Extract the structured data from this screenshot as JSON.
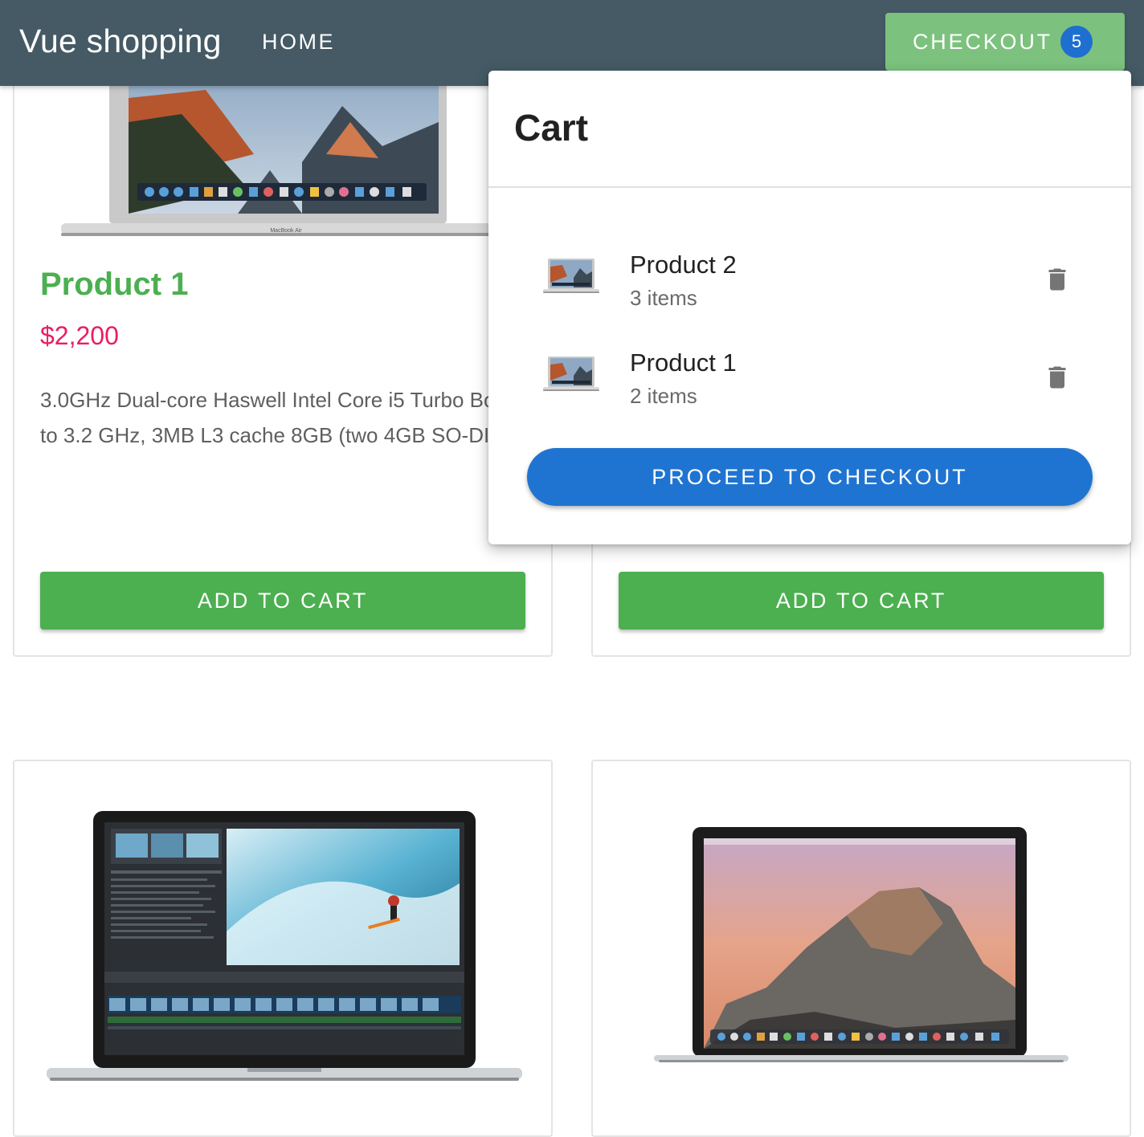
{
  "header": {
    "brand": "Vue shopping",
    "nav_home": "HOME",
    "checkout_label": "CHECKOUT",
    "cart_count": "5"
  },
  "products": [
    {
      "title": "Product 1",
      "price": "$2,200",
      "description": "3.0GHz Dual-core Haswell Intel Core i5 Turbo Boost up to 3.2 GHz, 3MB L3 cache 8GB (two 4GB SO-DIMMs...",
      "add_label": "ADD TO CART"
    },
    {
      "add_label": "ADD TO CART"
    }
  ],
  "cart": {
    "title": "Cart",
    "items": [
      {
        "name": "Product 2",
        "qty": "3 items"
      },
      {
        "name": "Product 1",
        "qty": "2 items"
      }
    ],
    "proceed_label": "PROCEED TO CHECKOUT"
  },
  "colors": {
    "topbar": "#455a64",
    "checkout_button": "#7cc27e",
    "badge": "#1e6fd0",
    "product_title": "#4caf50",
    "price": "#e91e63",
    "add_button": "#4caf50",
    "proceed_button": "#1f74d1"
  },
  "icons": [
    "trash-icon",
    "laptop-thumbnail"
  ]
}
